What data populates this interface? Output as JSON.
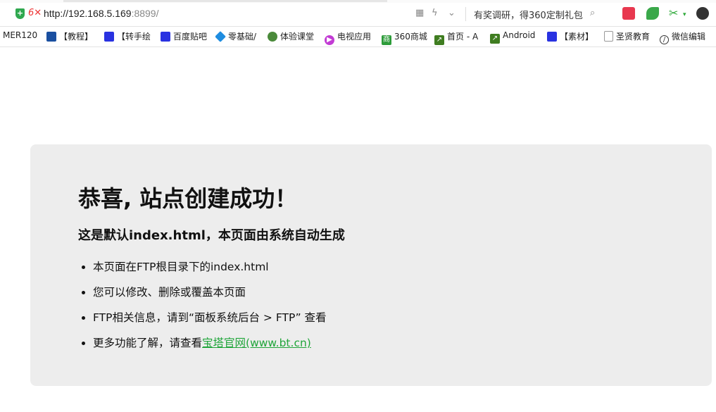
{
  "browser": {
    "url_host": "http://192.168.5.169",
    "url_port": ":8899/",
    "promo_text": "有奖调研，得360定制礼包"
  },
  "bookmarks": [
    {
      "label": "MER120",
      "icon": "red-bar-icon",
      "color": "#d33"
    },
    {
      "label": "【教程】",
      "icon": "bookmark-icon",
      "color": "#1a4fa0"
    },
    {
      "label": "【转手绘",
      "icon": "paw-icon",
      "color": "#2932e1"
    },
    {
      "label": "百度贴吧",
      "icon": "paw-icon",
      "color": "#2932e1"
    },
    {
      "label": "零基础/",
      "icon": "diamond-icon",
      "color": "#1f8de0"
    },
    {
      "label": "体验课堂",
      "icon": "tree-icon",
      "color": "#4a8a3a"
    },
    {
      "label": "电视应用",
      "icon": "play-icon",
      "color": "#c23bd4"
    },
    {
      "label": "360商城",
      "icon": "shop-icon",
      "color": "#2e9c3a"
    },
    {
      "label": "首页 - A",
      "icon": "arrow-icon",
      "color": "#3f7d20"
    },
    {
      "label": "Android",
      "icon": "arrow-icon",
      "color": "#3f7d20"
    },
    {
      "label": "【素材】",
      "icon": "paw-icon",
      "color": "#2932e1"
    },
    {
      "label": "圣贤教育",
      "icon": "page-icon",
      "color": "#999999"
    },
    {
      "label": "微信编辑",
      "icon": "slash-icon",
      "color": "#333333"
    }
  ],
  "page": {
    "title": "恭喜, 站点创建成功！",
    "subtitle": "这是默认index.html，本页面由系统自动生成",
    "items": [
      "本页面在FTP根目录下的index.html",
      "您可以修改、删除或覆盖本页面",
      "FTP相关信息，请到“面板系统后台 > FTP” 查看",
      "更多功能了解，请查看"
    ],
    "link_text": "宝塔官网(www.bt.cn)"
  }
}
